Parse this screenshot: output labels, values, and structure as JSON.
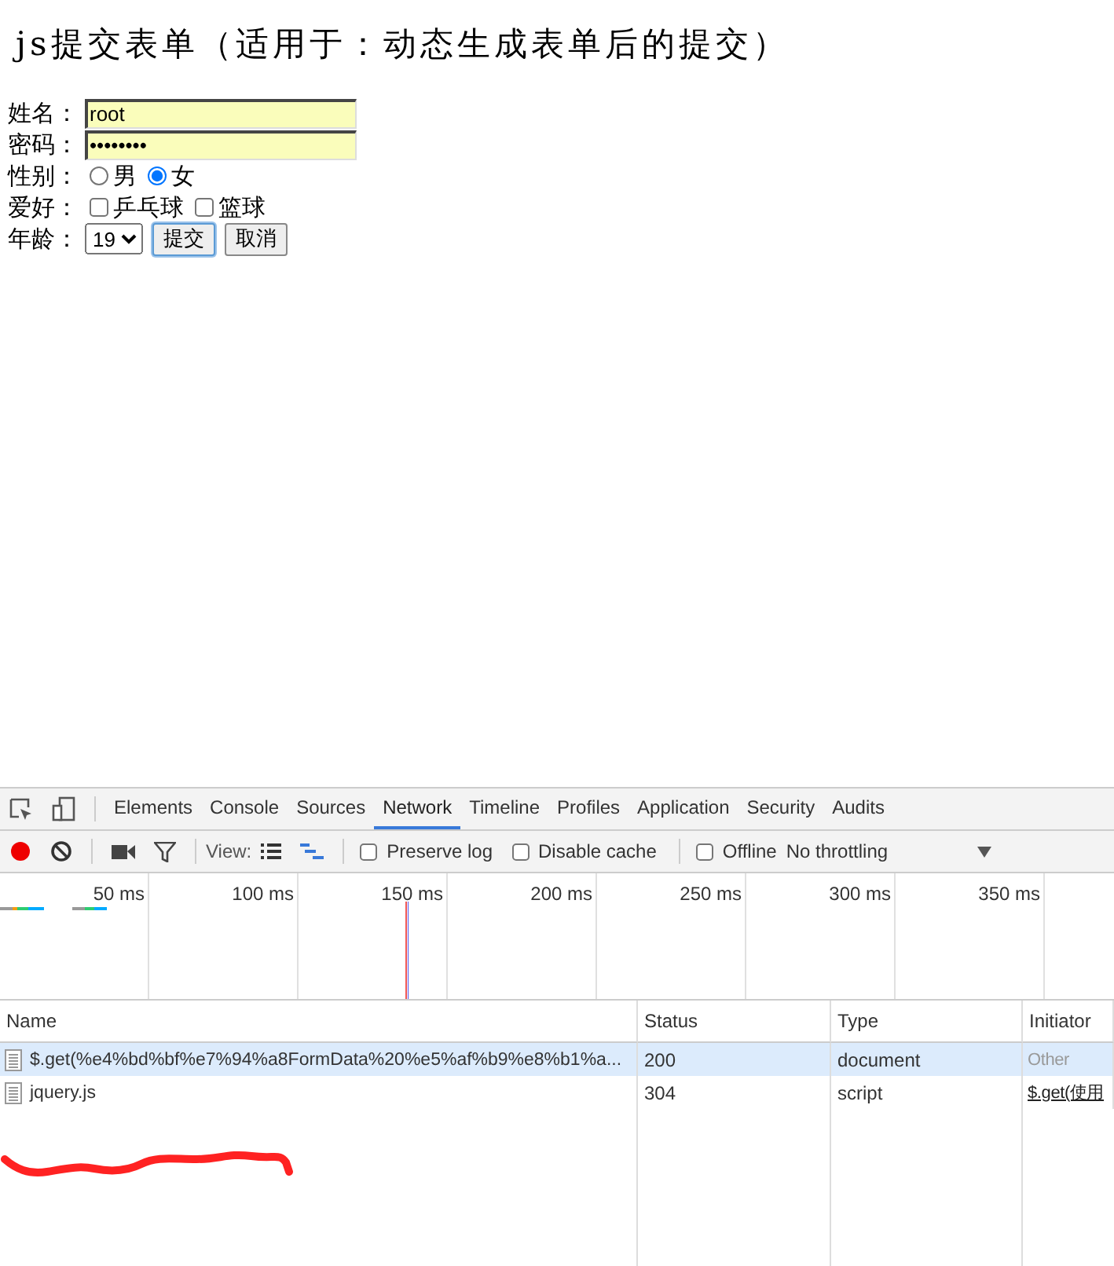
{
  "page": {
    "title": "js提交表单（适用于：动态生成表单后的提交）",
    "form": {
      "name": {
        "label": "姓名：",
        "value": "root"
      },
      "password": {
        "label": "密码：",
        "value": "••••••••"
      },
      "gender": {
        "label": "性别：",
        "options": [
          {
            "label": "男",
            "selected": false
          },
          {
            "label": "女",
            "selected": true
          }
        ]
      },
      "hobbies": {
        "label": "爱好：",
        "options": [
          {
            "label": "乒乓球",
            "checked": false
          },
          {
            "label": "篮球",
            "checked": false
          }
        ]
      },
      "age": {
        "label": "年龄：",
        "value": "19"
      },
      "buttons": [
        {
          "label": "提交",
          "focused": true
        },
        {
          "label": "取消",
          "focused": false
        }
      ]
    }
  },
  "devtools": {
    "tabs": [
      {
        "label": "Elements",
        "selected": false
      },
      {
        "label": "Console",
        "selected": false
      },
      {
        "label": "Sources",
        "selected": false
      },
      {
        "label": "Network",
        "selected": true
      },
      {
        "label": "Timeline",
        "selected": false
      },
      {
        "label": "Profiles",
        "selected": false
      },
      {
        "label": "Application",
        "selected": false
      },
      {
        "label": "Security",
        "selected": false
      },
      {
        "label": "Audits",
        "selected": false
      }
    ],
    "toolbar": {
      "recording": true,
      "view_label": "View:",
      "options": [
        {
          "label": "Preserve log",
          "checked": false
        },
        {
          "label": "Disable cache",
          "checked": false
        },
        {
          "label": "Offline",
          "checked": false
        }
      ],
      "throttling": "No throttling"
    },
    "timeline": {
      "ticks": [
        "50 ms",
        "100 ms",
        "150 ms",
        "200 ms",
        "250 ms",
        "300 ms",
        "350 ms"
      ]
    },
    "table": {
      "columns": [
        "Name",
        "Status",
        "Type",
        "Initiator"
      ],
      "rows": [
        {
          "name": "$.get(%e4%bd%bf%e7%94%a8FormData%20%e5%af%b9%e8%b1%a...",
          "status": "200",
          "type": "document",
          "initiator": "Other",
          "link": false,
          "selected": true
        },
        {
          "name": "jquery.js",
          "status": "304",
          "type": "script",
          "initiator": "$.get(使用",
          "link": true,
          "selected": false
        }
      ]
    }
  }
}
